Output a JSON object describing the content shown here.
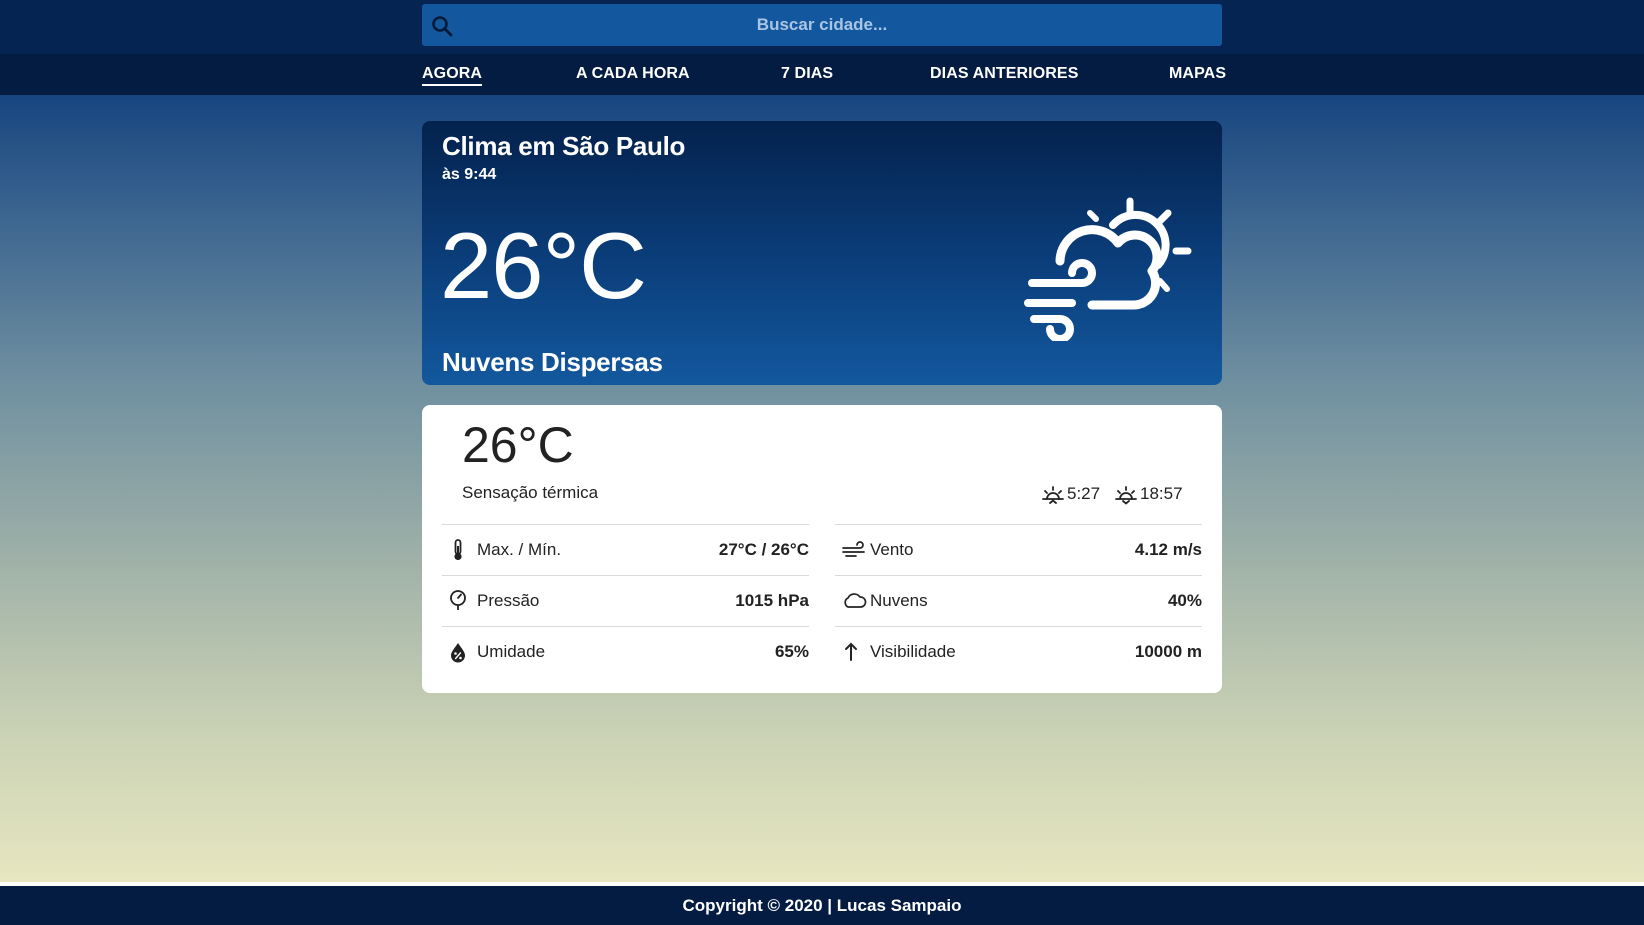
{
  "search": {
    "placeholder": "Buscar cidade...",
    "icon": "search-icon"
  },
  "nav": {
    "items": [
      {
        "label": "AGORA",
        "active": true
      },
      {
        "label": "A CADA HORA",
        "active": false
      },
      {
        "label": "7 DIAS",
        "active": false
      },
      {
        "label": "DIAS ANTERIORES",
        "active": false
      },
      {
        "label": "MAPAS",
        "active": false
      }
    ]
  },
  "current": {
    "title": "Clima em São Paulo",
    "time": "às 9:44",
    "temperature": "26°C",
    "description": "Nuvens Dispersas",
    "icon": "partly-cloudy-windy-sun-icon"
  },
  "details": {
    "feels_like": "26°C",
    "feels_like_label": "Sensação térmica",
    "sunrise": "5:27",
    "sunset": "18:57",
    "left": [
      {
        "label": "Max. / Mín.",
        "value": "27°C / 26°C",
        "icon": "thermometer-icon"
      },
      {
        "label": "Pressão",
        "value": "1015 hPa",
        "icon": "pressure-gauge-icon"
      },
      {
        "label": "Umidade",
        "value": "65%",
        "icon": "humidity-icon"
      }
    ],
    "right": [
      {
        "label": "Vento",
        "value": "4.12 m/s",
        "icon": "wind-icon"
      },
      {
        "label": "Nuvens",
        "value": "40%",
        "icon": "cloud-icon"
      },
      {
        "label": "Visibilidade",
        "value": "10000 m",
        "icon": "arrow-up-icon"
      }
    ]
  },
  "footer": {
    "text": "Copyright © 2020 | Lucas Sampaio"
  },
  "colors": {
    "topbar": "#062452",
    "navbar": "#041c42",
    "search_bg": "#13589e",
    "card_bg": "#ffffff"
  }
}
